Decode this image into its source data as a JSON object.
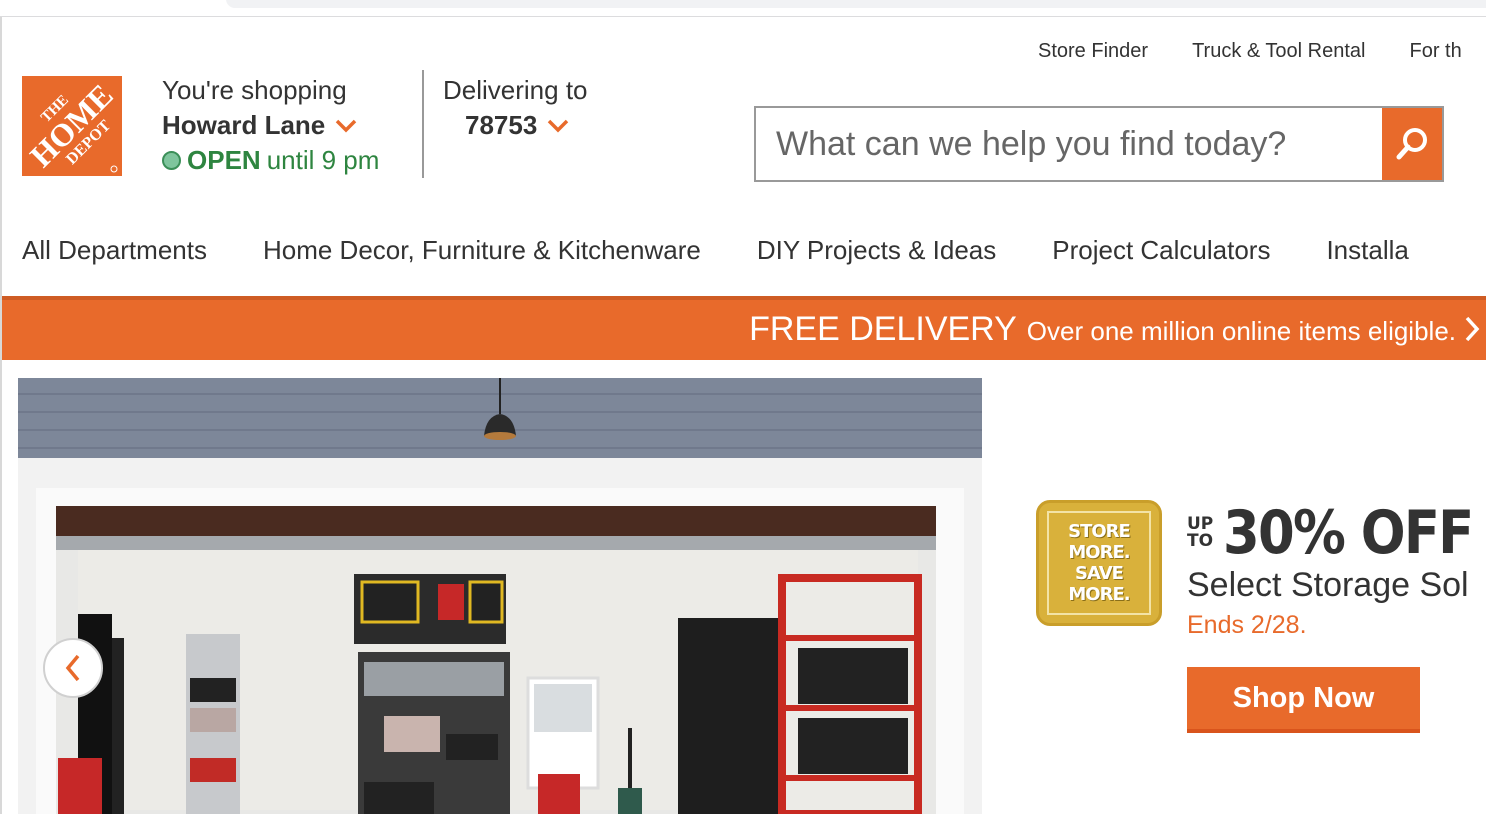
{
  "utility_nav": [
    "Store Finder",
    "Truck & Tool Rental",
    "For th"
  ],
  "logo": {
    "alt": "The Home Depot",
    "lines": [
      "THE",
      "HOME",
      "DEPOT"
    ],
    "color": "#e86a2b"
  },
  "store": {
    "label": "You're shopping",
    "name": "Howard Lane",
    "status_open": "OPEN",
    "status_hours": "until 9 pm"
  },
  "delivery": {
    "label": "Delivering to",
    "zip": "78753"
  },
  "search": {
    "placeholder": "What can we help you find today?",
    "value": ""
  },
  "main_nav": [
    "All Departments",
    "Home Decor, Furniture & Kitchenware",
    "DIY Projects & Ideas",
    "Project Calculators",
    "Installa"
  ],
  "promo_bar": {
    "headline": "FREE DELIVERY",
    "subtext": "Over one million online items eligible."
  },
  "hero": {
    "image_description": "Organized garage with shelving, storage bins and cabinets"
  },
  "offer": {
    "badge_lines": [
      "STORE",
      "MORE.",
      "SAVE",
      "MORE."
    ],
    "up_to": [
      "UP",
      "TO"
    ],
    "percent": "30% OFF",
    "description": "Select Storage Sol",
    "ends": "Ends 2/28.",
    "cta": "Shop Now"
  },
  "colors": {
    "brand_orange": "#e86a2b",
    "open_green": "#2e8540",
    "text": "#333333"
  }
}
